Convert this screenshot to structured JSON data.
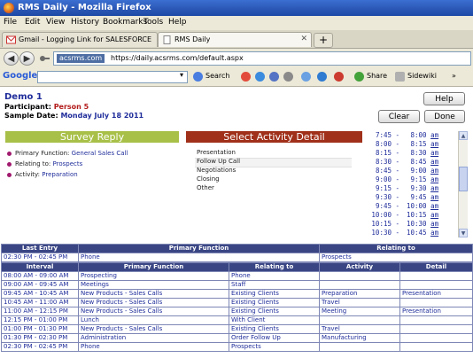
{
  "window": {
    "title": "RMS Daily - Mozilla Firefox"
  },
  "menu": [
    "File",
    "Edit",
    "View",
    "History",
    "Bookmarks",
    "Tools",
    "Help"
  ],
  "tabs": [
    {
      "label": "Gmail - Logging Link for SALESFORCE DE...",
      "icon": "gmail-icon",
      "active": false
    },
    {
      "label": "RMS Daily",
      "icon": "page-icon",
      "active": true
    }
  ],
  "nav": {
    "domain": "acsrms.com",
    "url": "https://daily.acsrms.com/default.aspx"
  },
  "google_toolbar": {
    "logo": "Google",
    "search_label": "Search",
    "share_label": "Share",
    "sidewiki_label": "Sidewiki"
  },
  "header": {
    "demo": "Demo 1",
    "participant_label": "Participant:",
    "participant_value": "Person 5",
    "sample_label": "Sample Date:",
    "sample_value": "Monday July 18 2011",
    "help_btn": "Help",
    "clear_btn": "Clear",
    "done_btn": "Done"
  },
  "survey": {
    "title": "Survey Reply",
    "color": "#a8c048",
    "items": [
      {
        "label": "Primary Function:",
        "value": "General Sales Call"
      },
      {
        "label": "Relating to:",
        "value": "Prospects"
      },
      {
        "label": "Activity:",
        "value": "Preparation"
      }
    ]
  },
  "activity_detail": {
    "title": "Select Activity Detail",
    "color": "#a0301a",
    "options": [
      "Presentation",
      "Follow Up Call",
      "Negotiations",
      "Closing",
      "Other"
    ],
    "selected": "Follow Up Call"
  },
  "times": [
    {
      "start": "7:45",
      "end": "8:00"
    },
    {
      "start": "8:00",
      "end": "8:15"
    },
    {
      "start": "8:15",
      "end": "8:30"
    },
    {
      "start": "8:30",
      "end": "8:45"
    },
    {
      "start": "8:45",
      "end": "9:00"
    },
    {
      "start": "9:00",
      "end": "9:15"
    },
    {
      "start": "9:15",
      "end": "9:30"
    },
    {
      "start": "9:30",
      "end": "9:45"
    },
    {
      "start": "9:45",
      "end": "10:00"
    },
    {
      "start": "10:00",
      "end": "10:15"
    },
    {
      "start": "10:15",
      "end": "10:30"
    },
    {
      "start": "10:30",
      "end": "10:45"
    }
  ],
  "time_suffix": "am",
  "last_entry": {
    "headers": [
      "Last Entry",
      "Primary Function",
      "Relating to"
    ],
    "row": [
      "02:30 PM - 02:45 PM",
      "Phone",
      "Prospects"
    ]
  },
  "intervals": {
    "headers": [
      "Interval",
      "Primary Function",
      "Relating to",
      "Activity",
      "Detail"
    ],
    "rows": [
      [
        "08:00 AM - 09:00 AM",
        "Prospecting",
        "Phone",
        "",
        ""
      ],
      [
        "09:00 AM - 09:45 AM",
        "Meetings",
        "Staff",
        "",
        ""
      ],
      [
        "09:45 AM - 10:45 AM",
        "New Products - Sales Calls",
        "Existing Clients",
        "Preparation",
        "Presentation"
      ],
      [
        "10:45 AM - 11:00 AM",
        "New Products - Sales Calls",
        "Existing Clients",
        "Travel",
        ""
      ],
      [
        "11:00 AM - 12:15 PM",
        "New Products - Sales Calls",
        "Existing Clients",
        "Meeting",
        "Presentation"
      ],
      [
        "12:15 PM - 01:00 PM",
        "Lunch",
        "With Client",
        "",
        ""
      ],
      [
        "01:00 PM - 01:30 PM",
        "New Products - Sales Calls",
        "Existing Clients",
        "Travel",
        ""
      ],
      [
        "01:30 PM - 02:30 PM",
        "Administration",
        "Order Follow Up",
        "Manufacturing",
        ""
      ],
      [
        "02:30 PM - 02:45 PM",
        "Phone",
        "Prospects",
        "",
        ""
      ]
    ]
  }
}
